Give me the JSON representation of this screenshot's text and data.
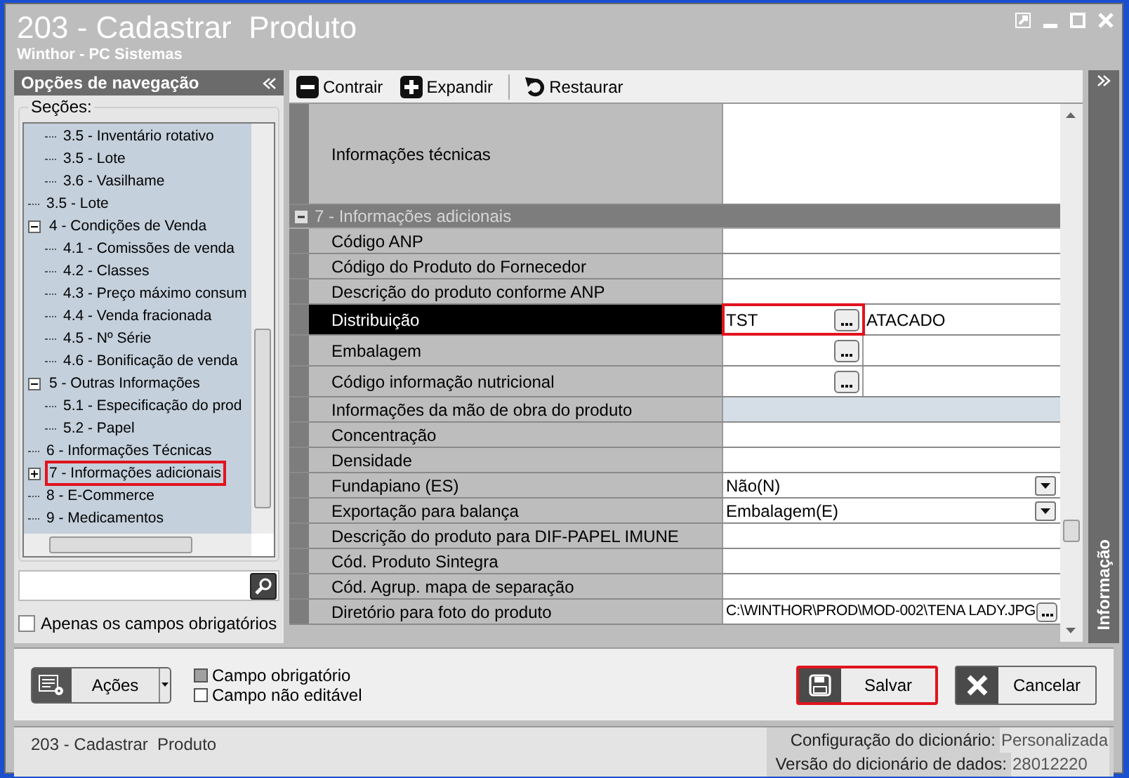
{
  "window": {
    "title": "203 - Cadastrar  Produto",
    "subtitle": "Winthor - PC Sistemas"
  },
  "navigation": {
    "title": "Opções de navegação",
    "group_label": "Seções:",
    "tree": [
      {
        "children": [
          {
            "label": "3.5 - Inventário rotativo",
            "highlighted": false
          },
          {
            "label": "3.5 - Lote",
            "highlighted": false
          },
          {
            "label": "3.6 - Vasilhame",
            "highlighted": false
          }
        ]
      },
      {
        "label": "3.5 - Lote",
        "highlighted": false
      },
      {
        "label": "4 - Condições de Venda",
        "expanded": true,
        "highlighted": false,
        "children": [
          {
            "label": "4.1 - Comissões de venda",
            "highlighted": false
          },
          {
            "label": "4.2 - Classes",
            "highlighted": false
          },
          {
            "label": "4.3 - Preço máximo consum",
            "highlighted": false
          },
          {
            "label": "4.4 - Venda fracionada",
            "highlighted": false
          },
          {
            "label": "4.5 - Nº Série",
            "highlighted": false
          },
          {
            "label": "4.6 - Bonificação de venda",
            "highlighted": false
          }
        ]
      },
      {
        "label": "5 - Outras Informações",
        "expanded": true,
        "highlighted": false,
        "children": [
          {
            "label": "5.1 - Especificação do prod",
            "highlighted": false
          },
          {
            "label": "5.2 - Papel",
            "highlighted": false
          }
        ]
      },
      {
        "label": "6 - Informações Técnicas",
        "highlighted": false
      },
      {
        "label": "7 - Informações adicionais",
        "expanded": false,
        "highlighted": true
      },
      {
        "label": "8 - E-Commerce",
        "highlighted": false
      },
      {
        "label": "9 - Medicamentos",
        "highlighted": false
      }
    ],
    "only_required": {
      "label": "Apenas os campos obrigatórios",
      "checked": false
    }
  },
  "toolbar": [
    "Contrair",
    "Expandir",
    "Restaurar"
  ],
  "grid": {
    "rows": [
      {
        "kind": "memo",
        "label": "Informações técnicas",
        "selected": false,
        "disabled": false
      },
      {
        "kind": "section",
        "label": "7 - Informações adicionais",
        "expanded": true
      },
      {
        "kind": "text",
        "label": "Código ANP",
        "selected": false,
        "disabled": false
      },
      {
        "kind": "text",
        "label": "Código do Produto do Fornecedor",
        "selected": false,
        "disabled": false
      },
      {
        "kind": "text",
        "label": "Descrição do produto conforme ANP",
        "selected": false,
        "disabled": false
      },
      {
        "kind": "lookup",
        "label": "Distribuição",
        "value": "TST",
        "description": "ATACADO",
        "selected": true,
        "disabled": false,
        "highlighted": true
      },
      {
        "kind": "lookup",
        "label": "Embalagem",
        "selected": false,
        "disabled": false,
        "highlighted": false
      },
      {
        "kind": "lookup",
        "label": "Código informação nutricional",
        "selected": false,
        "disabled": false,
        "highlighted": false
      },
      {
        "kind": "text",
        "label": "Informações da mão de obra do produto",
        "selected": false,
        "disabled": true
      },
      {
        "kind": "text",
        "label": "Concentração",
        "selected": false,
        "disabled": false
      },
      {
        "kind": "text",
        "label": "Densidade",
        "selected": false,
        "disabled": false
      },
      {
        "kind": "select",
        "label": "Fundapiano (ES)",
        "value": "Não(N)",
        "selected": false,
        "disabled": false
      },
      {
        "kind": "select",
        "label": "Exportação para balança",
        "value": "Embalagem(E)",
        "selected": false,
        "disabled": false
      },
      {
        "kind": "text",
        "label": "Descrição do produto para DIF-PAPEL IMUNE",
        "selected": false,
        "disabled": false
      },
      {
        "kind": "text",
        "label": "Cód. Produto Sintegra",
        "selected": false,
        "disabled": false
      },
      {
        "kind": "text",
        "label": "Cód. Agrup. mapa de separação",
        "selected": false,
        "disabled": false
      },
      {
        "kind": "file",
        "label": "Diretório para foto do produto",
        "value": "C:\\WINTHOR\\PROD\\MOD-002\\TENA LADY.JPG",
        "selected": false,
        "disabled": false
      }
    ]
  },
  "info_panel": {
    "title": "Informação"
  },
  "actions_button": "Ações",
  "legend": [
    {
      "label": "Campo obrigatório",
      "color": "#a0a0a0"
    },
    {
      "label": "Campo não editável",
      "color": "#ffffff"
    }
  ],
  "buttons": [
    {
      "kind": "save",
      "label": "Salvar",
      "highlighted": true
    },
    {
      "kind": "cancel",
      "label": "Cancelar",
      "highlighted": false
    }
  ],
  "status_bar": {
    "screen": "203 - Cadastrar  Produto",
    "items": [
      {
        "label": "Configuração do dicionário:",
        "value": "Personalizada"
      },
      {
        "label": "Versão do dicionário de dados:",
        "value": "28012220"
      }
    ]
  }
}
